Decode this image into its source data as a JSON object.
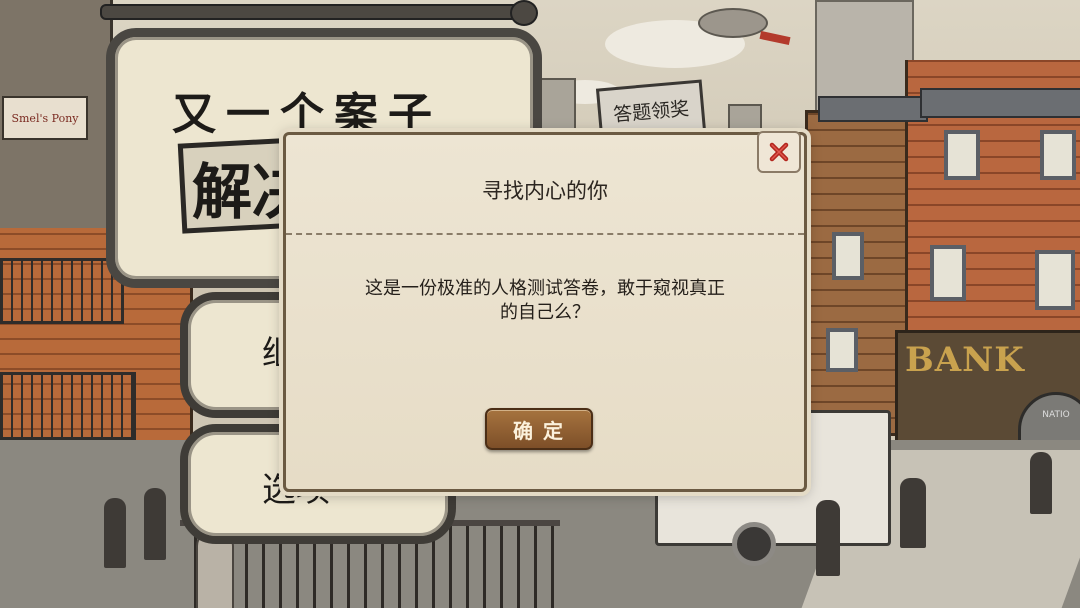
{
  "game_menu": {
    "title_line1": "又一个案子",
    "title_line2": "解决",
    "menu_item_partial": "继",
    "menu_item_options": "选项"
  },
  "scene": {
    "shop_sign": "Smel's Pony",
    "quiz_sign": "答题领奖",
    "bank_sign": "BANK",
    "nation_sign": "NATIO"
  },
  "dialog": {
    "title": "寻找内心的你",
    "message_line1": "这是一份极准的人格测试答卷，敢于窥视真正",
    "message_line2": "的自己么？",
    "confirm_label": "确定",
    "close_icon": "close-icon"
  },
  "colors": {
    "dialog_bg": "#ede5d3",
    "button_bg": "#8c5c30",
    "close_icon_red": "#b3261e"
  }
}
